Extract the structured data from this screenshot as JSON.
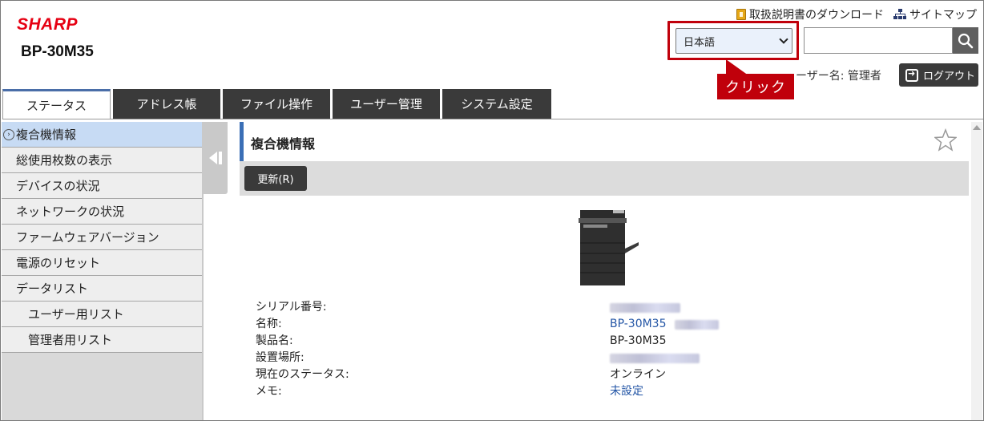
{
  "header": {
    "brand": "SHARP",
    "model": "BP-30M35",
    "manual_link": "取扱説明書のダウンロード",
    "sitemap_link": "サイトマップ",
    "language_selected": "日本語",
    "search_placeholder": "",
    "callout": "クリック",
    "user_label": "ーザー名: 管理者",
    "logout_label": "ログアウト"
  },
  "tabs": [
    {
      "label": "ステータス",
      "active": true
    },
    {
      "label": "アドレス帳"
    },
    {
      "label": "ファイル操作"
    },
    {
      "label": "ユーザー管理"
    },
    {
      "label": "システム設定"
    }
  ],
  "sidebar": {
    "items": [
      {
        "label": "複合機情報",
        "active": true
      },
      {
        "label": "総使用枚数の表示"
      },
      {
        "label": "デバイスの状況"
      },
      {
        "label": "ネットワークの状況"
      },
      {
        "label": "ファームウェアバージョン"
      },
      {
        "label": "電源のリセット"
      },
      {
        "label": "データリスト"
      },
      {
        "label": "ユーザー用リスト",
        "sub": true
      },
      {
        "label": "管理者用リスト",
        "sub": true
      }
    ]
  },
  "main": {
    "title": "複合機情報",
    "refresh_label": "更新(R)",
    "rows": [
      {
        "label": "シリアル番号:",
        "value": ""
      },
      {
        "label": "名称:",
        "value": "BP-30M35"
      },
      {
        "label": "製品名:",
        "value": "BP-30M35"
      },
      {
        "label": "設置場所:",
        "value": ""
      },
      {
        "label": "現在のステータス:",
        "value": "オンライン"
      },
      {
        "label": "メモ:",
        "value": "未設定"
      }
    ]
  },
  "colors": {
    "brand": "#e60012",
    "highlight": "#c0000b",
    "accent": "#3b6fb6",
    "link": "#2456a6"
  }
}
